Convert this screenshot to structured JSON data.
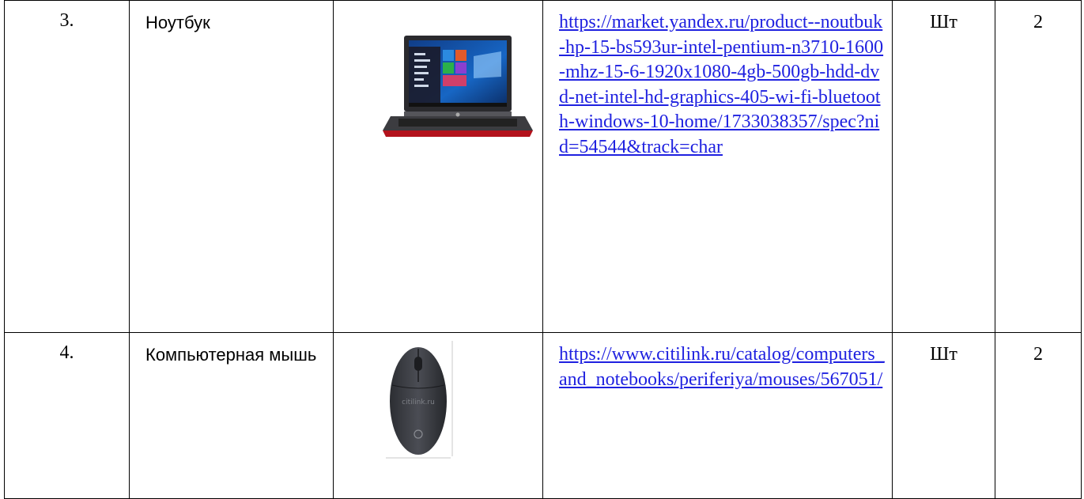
{
  "rows": [
    {
      "number": "3.",
      "name": "Ноутбук",
      "image_icon": "laptop-photo",
      "link": "https://market.yandex.ru/product--noutbuk-hp-15-bs593ur-intel-pentium-n3710-1600-mhz-15-6-1920x1080-4gb-500gb-hdd-dvd-net-intel-hd-graphics-405-wi-fi-bluetooth-windows-10-home/1733038357/spec?nid=54544&track=char",
      "unit": "Шт",
      "quantity": "2"
    },
    {
      "number": "4.",
      "name": "Компьютерная мышь",
      "image_icon": "mouse-photo",
      "image_watermark": "citilink.ru",
      "link": "https://www.citilink.ru/catalog/computers_and_notebooks/periferiya/mouses/567051/",
      "unit": "Шт",
      "quantity": "2"
    }
  ],
  "colors": {
    "link": "#1f21e0",
    "border": "#000000",
    "laptop_accent": "#b3121c"
  }
}
